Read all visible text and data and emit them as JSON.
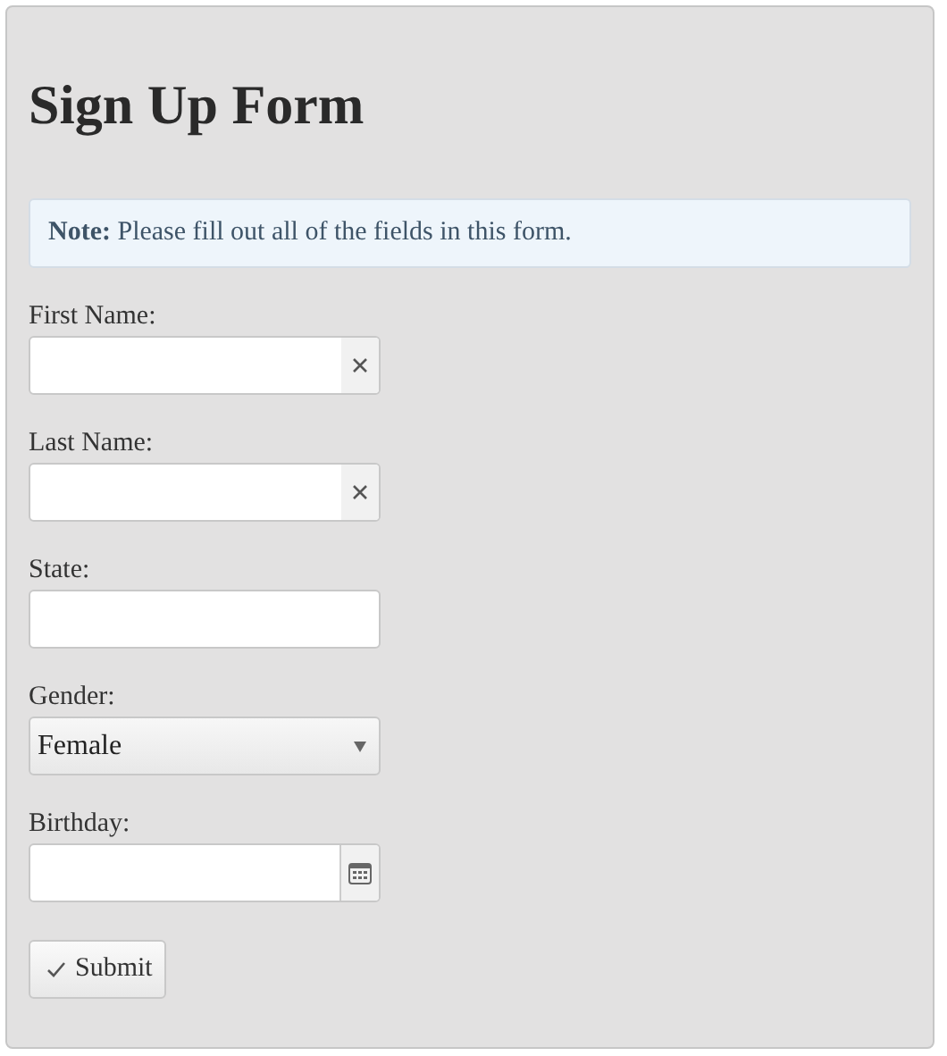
{
  "title": "Sign Up Form",
  "note": "**Note:** Please fill out all of the fields in this form.",
  "fields": [
    {
      "label": "First Name:",
      "kind": "clearable"
    },
    {
      "label": "Last Name:",
      "kind": "clearable"
    },
    {
      "label": "State:",
      "kind": "text"
    },
    {
      "label": "Gender:",
      "kind": "select",
      "value": "Female"
    },
    {
      "label": "Birthday:",
      "kind": "date"
    }
  ],
  "submit": "Submit"
}
